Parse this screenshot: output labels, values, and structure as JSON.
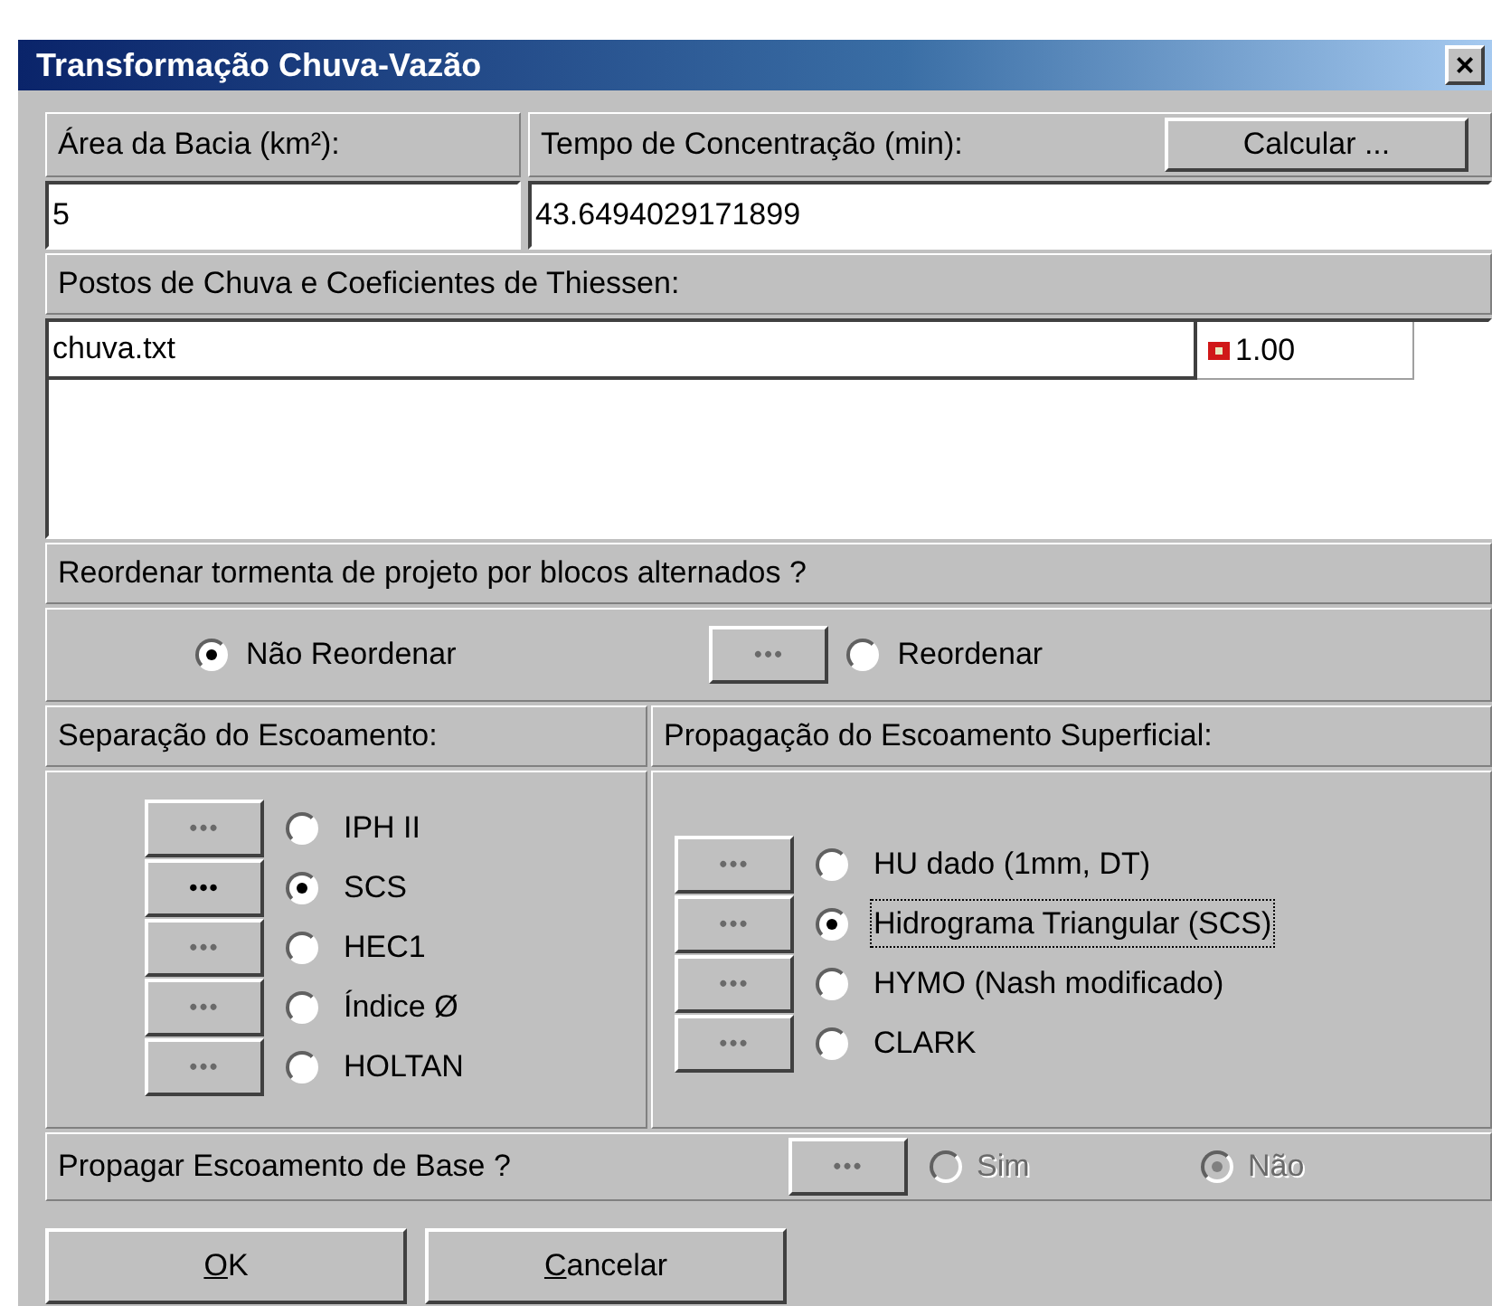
{
  "window": {
    "title": "Transformação Chuva-Vazão",
    "close_label": "×"
  },
  "area": {
    "label": "Área da Bacia (km²):",
    "value": "5"
  },
  "tc": {
    "label": "Tempo de Concentração (min):",
    "value": "43.6494029171899",
    "button": "Calcular ..."
  },
  "gauges": {
    "label": "Postos de Chuva e Coeficientes de Thiessen:",
    "rows": [
      {
        "file": "chuva.txt",
        "coefficient": "1.00"
      }
    ]
  },
  "reorder": {
    "question": "Reordenar tormenta de projeto por blocos alternados ?",
    "options": [
      {
        "label": "Não Reordenar",
        "selected": true
      },
      {
        "label": "Reordenar",
        "selected": false,
        "button": {
          "label": "•••",
          "disabled": true
        }
      }
    ]
  },
  "separation": {
    "label": "Separação do Escoamento:",
    "options": [
      {
        "label": "IPH II",
        "selected": false,
        "focused": false,
        "button": {
          "label": "•••",
          "disabled": true
        }
      },
      {
        "label": "SCS",
        "selected": true,
        "focused": false,
        "button": {
          "label": "•••",
          "disabled": false
        }
      },
      {
        "label": "HEC1",
        "selected": false,
        "focused": false,
        "button": {
          "label": "•••",
          "disabled": true
        }
      },
      {
        "label": "Índice Ø",
        "selected": false,
        "focused": false,
        "button": {
          "label": "•••",
          "disabled": true
        }
      },
      {
        "label": "HOLTAN",
        "selected": false,
        "focused": false,
        "button": {
          "label": "•••",
          "disabled": true
        }
      }
    ]
  },
  "propagation": {
    "label": "Propagação do Escoamento Superficial:",
    "options": [
      {
        "label": "HU dado (1mm, DT)",
        "selected": false,
        "focused": false,
        "button": {
          "label": "•••",
          "disabled": true
        }
      },
      {
        "label": "Hidrograma Triangular (SCS)",
        "selected": true,
        "focused": true,
        "button": {
          "label": "•••",
          "disabled": true
        }
      },
      {
        "label": "HYMO (Nash modificado)",
        "selected": false,
        "focused": false,
        "button": {
          "label": "•••",
          "disabled": true
        }
      },
      {
        "label": "CLARK",
        "selected": false,
        "focused": false,
        "button": {
          "label": "•••",
          "disabled": true
        }
      }
    ]
  },
  "base": {
    "question": "Propagar Escoamento de Base ?",
    "button": {
      "label": "•••",
      "disabled": true
    },
    "options": [
      {
        "label": "Sim",
        "selected": false,
        "disabled": true
      },
      {
        "label": "Não",
        "selected": true,
        "disabled": true
      }
    ]
  },
  "buttons": [
    {
      "accel": "O",
      "rest": "K"
    },
    {
      "accel": "C",
      "rest": "ancelar"
    }
  ]
}
